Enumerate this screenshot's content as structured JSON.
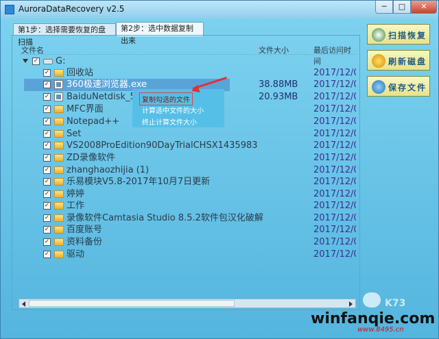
{
  "window": {
    "title": "AuroraDataRecovery v2.5"
  },
  "window_controls": {
    "minimize": "─",
    "maximize": "□",
    "close": "✕"
  },
  "tabs": [
    {
      "label": "第1步：选择需要恢复的盘扫描"
    },
    {
      "label": "第2步：选中数据复制出来"
    }
  ],
  "columns": {
    "name": "文件名",
    "size": "文件大小",
    "date": "最后访问时间"
  },
  "tree": {
    "drive_label": "G:",
    "items": [
      {
        "name": "回收站",
        "type": "folder",
        "size": "",
        "date": "2017/12/0"
      },
      {
        "name": "360极速浏览器.exe",
        "type": "file",
        "size": "38.88MB",
        "date": "2017/12/0"
      },
      {
        "name": "BaiduNetdisk_5.5",
        "type": "file",
        "size": "20.93MB",
        "date": "2017/12/0"
      },
      {
        "name": "MFC界面",
        "type": "folder",
        "size": "",
        "date": "2017/12/0"
      },
      {
        "name": "Notepad++",
        "type": "folder",
        "size": "",
        "date": "2017/12/0"
      },
      {
        "name": "Set",
        "type": "folder",
        "size": "",
        "date": "2017/12/0"
      },
      {
        "name": "VS2008ProEdition90DayTrialCHSX1435983",
        "type": "folder",
        "size": "",
        "date": "2017/12/0"
      },
      {
        "name": "ZD录像软件",
        "type": "folder",
        "size": "",
        "date": "2017/12/0"
      },
      {
        "name": "zhanghaozhijia (1)",
        "type": "folder",
        "size": "",
        "date": "2017/12/0"
      },
      {
        "name": "乐易模块V5.8-2017年10月7日更新",
        "type": "folder",
        "size": "",
        "date": "2017/12/0"
      },
      {
        "name": "婷婷",
        "type": "folder",
        "size": "",
        "date": "2017/12/0"
      },
      {
        "name": "工作",
        "type": "folder",
        "size": "",
        "date": "2017/12/0"
      },
      {
        "name": "录像软件Camtasia Studio 8.5.2软件包汉化破解",
        "type": "folder",
        "size": "",
        "date": "2017/12/0"
      },
      {
        "name": "百度账号",
        "type": "folder",
        "size": "",
        "date": "2017/12/0"
      },
      {
        "name": "资料备份",
        "type": "folder",
        "size": "",
        "date": "2017/12/0"
      },
      {
        "name": "驱动",
        "type": "folder",
        "size": "",
        "date": "2017/12/0"
      }
    ]
  },
  "context_menu": {
    "items": [
      "复制勾选的文件",
      "计算选中文件的大小",
      "终止计算文件大小"
    ]
  },
  "side_buttons": {
    "scan": "扫描恢复",
    "refresh": "刷新磁盘",
    "save": "保存文件"
  },
  "watermarks": {
    "main": "winfanqie.com",
    "sub": "www.8495.cn",
    "corner": "K73"
  }
}
